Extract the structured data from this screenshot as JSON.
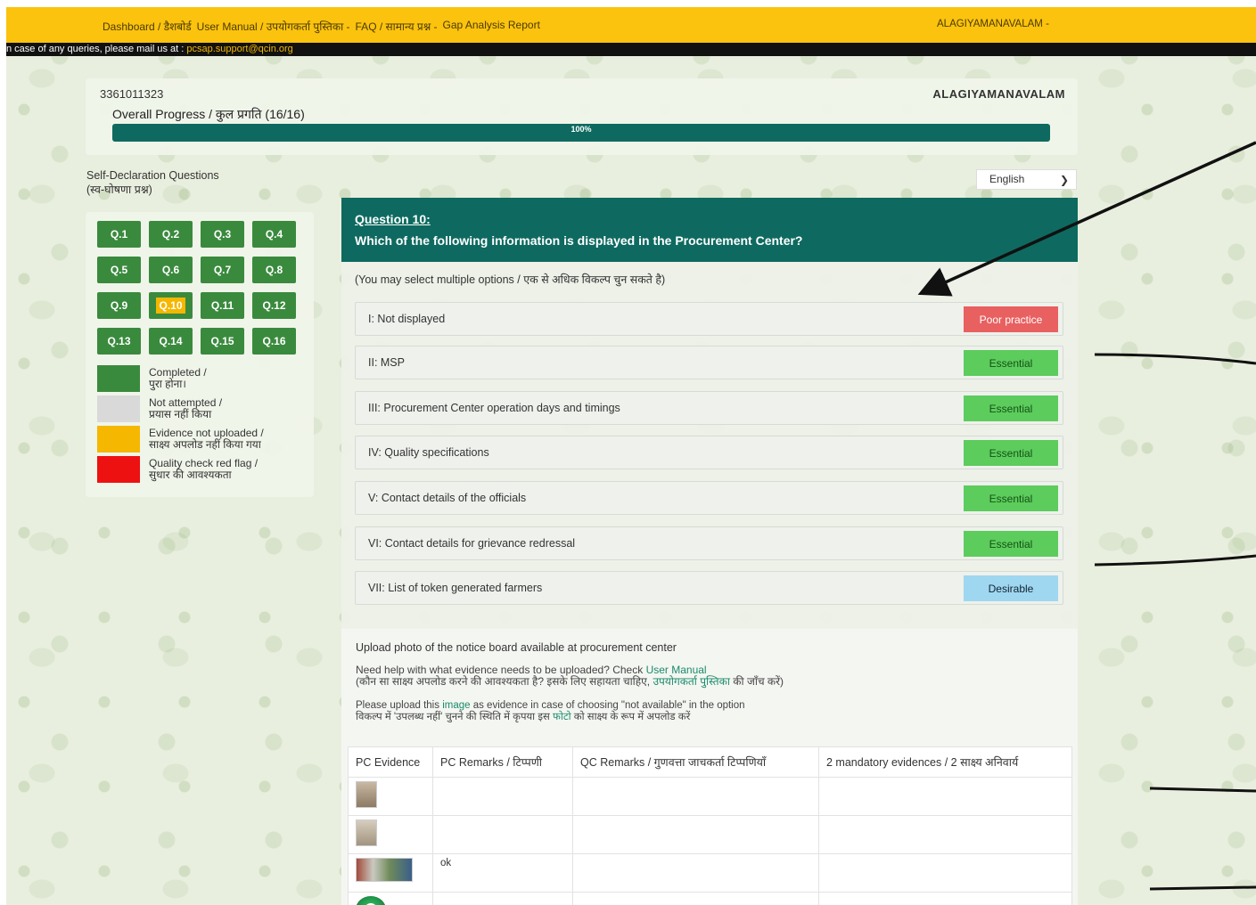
{
  "nav": {
    "dashboard": "Dashboard / डैशबोर्ड",
    "manual": "User Manual / उपयोगकर्ता पुस्तिका -",
    "faq": "FAQ / सामान्य प्रश्न -",
    "gap": "Gap Analysis Report",
    "user": "ALAGIYAMANAVALAM -"
  },
  "info": {
    "text": "n case of any queries, please mail us at : ",
    "email": "pcsap.support@qcin.org"
  },
  "header": {
    "center_id": "3361011323",
    "center_name": "ALAGIYAMANAVALAM",
    "progress_label": "Overall Progress / कुल प्रगति (16/16)",
    "progress_text": "100%",
    "progress_value": 1.0
  },
  "sidebar": {
    "title_line1": "Self-Declaration Questions",
    "title_line2": "(स्व-घोषणा प्रश्न)",
    "questions": [
      "Q.1",
      "Q.2",
      "Q.3",
      "Q.4",
      "Q.5",
      "Q.6",
      "Q.7",
      "Q.8",
      "Q.9",
      "Q.10",
      "Q.11",
      "Q.12",
      "Q.13",
      "Q.14",
      "Q.15",
      "Q.16"
    ],
    "legend": [
      {
        "line1": "Completed /",
        "line2": "पुरा होना।",
        "color": "#3a8a3e"
      },
      {
        "line1": "Not attempted /",
        "line2": "प्रयास नहीं किया",
        "color": "#d9d9d9"
      },
      {
        "line1": "Evidence not uploaded /",
        "line2": "साक्ष्य अपलोड नहीं किया गया",
        "color": "#f5b700"
      },
      {
        "line1": "Quality check red flag /",
        "line2": "सुधार की आवश्यकता",
        "color": "#ee1111"
      }
    ]
  },
  "language": {
    "selected": "English"
  },
  "question": {
    "number": "Question 10:",
    "text": "Which of the following information is displayed in the Procurement Center?",
    "hint": "(You may select multiple options / एक से अधिक विकल्प चुन सकते है)",
    "options": [
      {
        "label": "I: Not displayed",
        "tag": "Poor practice"
      },
      {
        "label": "II: MSP",
        "tag": "Essential"
      },
      {
        "label": "III: Procurement Center operation days and timings",
        "tag": "Essential"
      },
      {
        "label": "IV: Quality specifications",
        "tag": "Essential"
      },
      {
        "label": "V: Contact details of the officials",
        "tag": "Essential"
      },
      {
        "label": "VI: Contact details for grievance redressal",
        "tag": "Essential"
      },
      {
        "label": "VII: List of token generated farmers",
        "tag": "Desirable"
      }
    ]
  },
  "upload": {
    "title": "Upload photo of the notice board available at procurement center",
    "help1_pre": "Need help with what evidence needs to be uploaded? Check ",
    "help1_link": "User Manual",
    "help2_pre": "(कौन सा साक्ष्य अपलोड करने की आवश्यकता है? इसके लिए सहायता चाहिए, ",
    "help2_link": "उपयोगकर्ता पुस्तिका",
    "help2_post": " की जाँच करें)",
    "note1_pre": "Please upload this ",
    "note1_link": "image",
    "note1_post": " as evidence in case of choosing \"not available\" in the option",
    "note2_pre": "विकल्प में 'उपलब्ध नहीं' चुनने की स्थिति में कृपया इस ",
    "note2_link": "फोटो",
    "note2_post": " को साक्ष्य के रूप में अपलोड करें",
    "columns": [
      "PC Evidence",
      "PC Remarks / टिप्पणी",
      "QC Remarks / गुणवत्ता जाचकर्ता टिप्पणियाँ",
      "2 mandatory evidences / 2 साक्ष्य अनिवार्य"
    ],
    "rows": [
      {
        "remark": ""
      },
      {
        "remark": ""
      },
      {
        "remark": "ok"
      },
      {
        "remark": ""
      }
    ]
  }
}
